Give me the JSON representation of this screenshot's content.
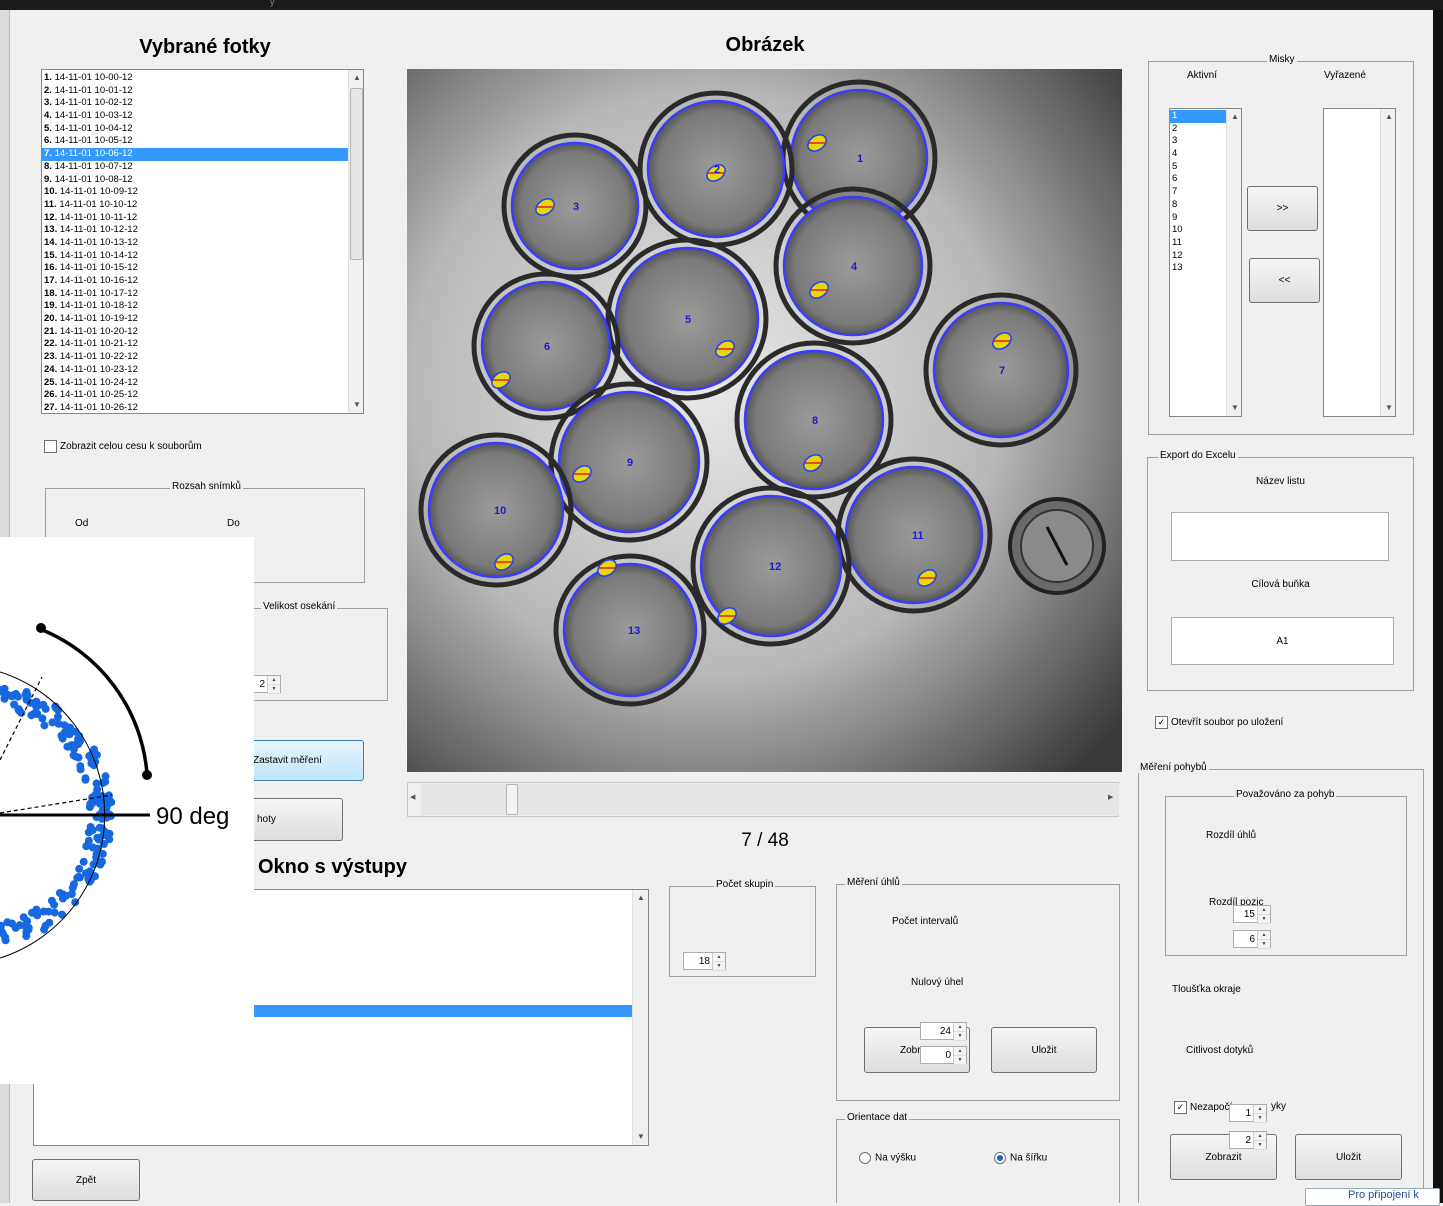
{
  "window": {
    "title_fragment": "y"
  },
  "left_panel": {
    "title": "Vybrané fotky",
    "photos": [
      {
        "n": "1.",
        "name": "14-11-01 10-00-12"
      },
      {
        "n": "2.",
        "name": "14-11-01 10-01-12"
      },
      {
        "n": "3.",
        "name": "14-11-01 10-02-12"
      },
      {
        "n": "4.",
        "name": "14-11-01 10-03-12"
      },
      {
        "n": "5.",
        "name": "14-11-01 10-04-12"
      },
      {
        "n": "6.",
        "name": "14-11-01 10-05-12"
      },
      {
        "n": "7.",
        "name": "14-11-01 10-06-12"
      },
      {
        "n": "8.",
        "name": "14-11-01 10-07-12"
      },
      {
        "n": "9.",
        "name": "14-11-01 10-08-12"
      },
      {
        "n": "10.",
        "name": "14-11-01 10-09-12"
      },
      {
        "n": "11.",
        "name": "14-11-01 10-10-12"
      },
      {
        "n": "12.",
        "name": "14-11-01 10-11-12"
      },
      {
        "n": "13.",
        "name": "14-11-01 10-12-12"
      },
      {
        "n": "14.",
        "name": "14-11-01 10-13-12"
      },
      {
        "n": "15.",
        "name": "14-11-01 10-14-12"
      },
      {
        "n": "16.",
        "name": "14-11-01 10-15-12"
      },
      {
        "n": "17.",
        "name": "14-11-01 10-16-12"
      },
      {
        "n": "18.",
        "name": "14-11-01 10-17-12"
      },
      {
        "n": "19.",
        "name": "14-11-01 10-18-12"
      },
      {
        "n": "20.",
        "name": "14-11-01 10-19-12"
      },
      {
        "n": "21.",
        "name": "14-11-01 10-20-12"
      },
      {
        "n": "22.",
        "name": "14-11-01 10-21-12"
      },
      {
        "n": "23.",
        "name": "14-11-01 10-22-12"
      },
      {
        "n": "24.",
        "name": "14-11-01 10-23-12"
      },
      {
        "n": "25.",
        "name": "14-11-01 10-24-12"
      },
      {
        "n": "26.",
        "name": "14-11-01 10-25-12"
      },
      {
        "n": "27.",
        "name": "14-11-01 10-26-12"
      }
    ],
    "selected_index": 6,
    "show_full_path_label": "Zobrazit celou cesu k souborům",
    "show_full_path_checked": false,
    "range_group": {
      "title": "Rozsah snímků",
      "from_label": "Od",
      "to_label": "Do"
    },
    "crop_group": {
      "title": "Velikost osekání",
      "value": "2"
    },
    "stop_button": "Zastavit měření",
    "values_button_fragment": "hoty",
    "back_button": "Zpět"
  },
  "overlay_plot": {
    "label": "90 deg"
  },
  "image_panel": {
    "title": "Obrázek",
    "frame_counter": "7 / 48",
    "dish_labels": [
      "1",
      "2",
      "3",
      "4",
      "5",
      "6",
      "7",
      "8",
      "9",
      "10",
      "11",
      "12",
      "13"
    ]
  },
  "output_window": {
    "title": "Okno s výstupy"
  },
  "groups_count": {
    "title": "Počet skupin",
    "value": "18"
  },
  "angle_measurement": {
    "title": "Měření úhlů",
    "intervals_label": "Počet intervalů",
    "intervals_value": "24",
    "zero_angle_label": "Nulový úhel",
    "zero_angle_value": "0",
    "show_button_fragment": "Zobr",
    "save_button": "Uložit"
  },
  "orientation": {
    "title": "Orientace dat",
    "portrait": "Na výšku",
    "landscape": "Na šířku",
    "selected": "landscape"
  },
  "dishes": {
    "title": "Misky",
    "active_label": "Aktivní",
    "excluded_label": "Vyřazené",
    "active_items": [
      "1",
      "2",
      "3",
      "4",
      "5",
      "6",
      "7",
      "8",
      "9",
      "10",
      "11",
      "12",
      "13"
    ],
    "active_selected_index": 0,
    "excluded_items": [],
    "move_right": ">>",
    "move_left": "<<"
  },
  "excel_export": {
    "title": "Export do Excelu",
    "sheet_name_label": "Název listu",
    "sheet_name_value": "",
    "target_cell_label": "Cílová buňka",
    "target_cell_value": "A1",
    "open_after_save_label": "Otevřít soubor po uložení",
    "open_after_save_checked": true
  },
  "motion_measurement": {
    "title": "Měření pohybů",
    "considered_title": "Považováno za pohyb",
    "angle_diff_label": "Rozdíl úhlů",
    "angle_diff_value": "15",
    "pos_diff_label": "Rozdíl pozic",
    "pos_diff_value": "6",
    "edge_label": "Tloušťka okraje",
    "edge_value": "1",
    "touch_label": "Citlivost dotyků",
    "touch_value": "2",
    "ignore_label_a": "Nezapočí",
    "ignore_label_b": "yky",
    "ignore_checked": true,
    "show_button": "Zobrazit",
    "save_button": "Uložit"
  },
  "taskbar": {
    "text": "Pro připojení k"
  }
}
